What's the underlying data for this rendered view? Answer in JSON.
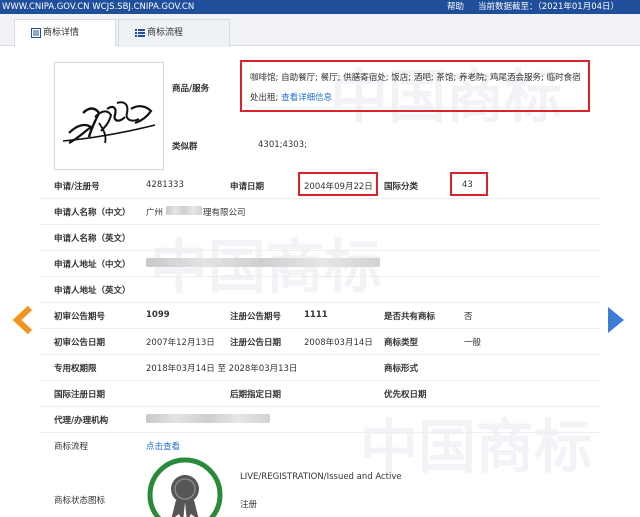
{
  "topbar": {
    "domains": "WWW.CNIPA.GOV.CN WCJS.SBJ.CNIPA.GOV.CN",
    "help": "帮助",
    "data_as_of": "当前数据截至：（2021年01月04日）"
  },
  "tabs": [
    {
      "label": "商标详情",
      "icon": "document-icon",
      "active": true
    },
    {
      "label": "商标流程",
      "icon": "list-icon",
      "active": false
    }
  ],
  "watermark": "中国商标",
  "trademark": {
    "goods_services_label": "商品/服务",
    "goods_services_value": "咖啡馆; 自助餐厅; 餐厅; 供膳寄宿处; 饭店; 酒吧; 茶馆; 养老院; 鸡尾酒会服务; 临时食宿处出租;",
    "view_details_link": "查看详细信息",
    "similar_group_label": "类似群",
    "similar_group_value": "4301;4303;",
    "reg_no_label": "申请/注册号",
    "reg_no_value": "4281333",
    "app_date_label": "申请日期",
    "app_date_value": "2004年09月22日",
    "intl_class_label": "国际分类",
    "intl_class_value": "43",
    "applicant_cn_label": "申请人名称（中文）",
    "applicant_cn_value_start": "广州",
    "applicant_cn_value_end": "理有限公司",
    "applicant_en_label": "申请人名称（英文）",
    "address_cn_label": "申请人地址（中文）",
    "address_en_label": "申请人地址（英文）",
    "prelim_issue_label": "初审公告期号",
    "prelim_issue_value": "1099",
    "reg_issue_label": "注册公告期号",
    "reg_issue_value": "1111",
    "shared_label": "是否共有商标",
    "shared_value": "否",
    "prelim_date_label": "初审公告日期",
    "prelim_date_value": "2007年12月13日",
    "reg_date_label": "注册公告日期",
    "reg_date_value": "2008年03月14日",
    "tm_type_label": "商标类型",
    "tm_type_value": "一般",
    "exclusive_period_label": "专用权期限",
    "exclusive_period_value": "2018年03月14日 至 2028年03月13日",
    "tm_form_label": "商标形式",
    "intl_reg_date_label": "国际注册日期",
    "later_designation_label": "后期指定日期",
    "priority_date_label": "优先权日期",
    "agent_label": "代理/办理机构",
    "flow_label": "商标流程",
    "flow_link": "点击查看",
    "status_icon_label": "商标状态图标",
    "status_en": "LIVE/REGISTRATION/Issued and Active",
    "status_cn": "注册"
  },
  "colors": {
    "topbar": "#1f4e9a",
    "highlight_box": "#d9242b",
    "link": "#1d6fd1",
    "prev_arrow": "#f0951e",
    "next_arrow": "#3d7ed4",
    "badge_ring": "#2a8a3a"
  }
}
